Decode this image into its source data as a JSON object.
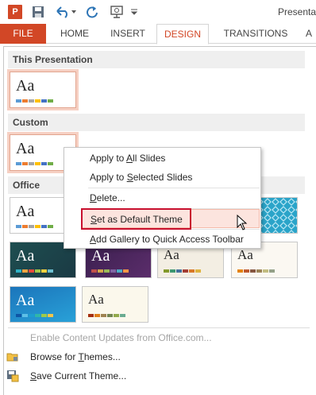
{
  "window": {
    "title_fragment": "Presenta"
  },
  "ribbon": {
    "tabs": [
      "FILE",
      "HOME",
      "INSERT",
      "DESIGN",
      "TRANSITIONS",
      "A"
    ],
    "active_tab": "DESIGN"
  },
  "sections": {
    "this_presentation": "This Presentation",
    "custom": "Custom",
    "office": "Office"
  },
  "thumb_text": "Aa",
  "context_menu": {
    "items": [
      {
        "label": "Apply to All Slides",
        "pre": "Apply to ",
        "key": "A",
        "post": "ll Slides"
      },
      {
        "label": "Apply to Selected Slides",
        "pre": "Apply to ",
        "key": "S",
        "post": "elected Slides"
      },
      {
        "label": "Delete...",
        "pre": "",
        "key": "D",
        "post": "elete..."
      },
      {
        "label": "Set as Default Theme",
        "pre": "",
        "key": "S",
        "post": "et as Default Theme"
      },
      {
        "label": "Add Gallery to Quick Access Toolbar",
        "pre": "",
        "key": "A",
        "post": "dd Gallery to Quick Access Toolbar"
      }
    ],
    "highlighted_index": 3
  },
  "bottom": {
    "enable_updates": "Enable Content Updates from Office.com...",
    "browse_pre": "Browse for ",
    "browse_key": "T",
    "browse_post": "hemes...",
    "save_pre": "",
    "save_key": "S",
    "save_post": "ave Current Theme..."
  },
  "colors": {
    "accent": "#d24726",
    "highlight_bg": "#fce4de",
    "annotation_box": "#c8102e",
    "office_theme_bars": [
      "#5b9bd5",
      "#ed7d31",
      "#a5a5a5",
      "#ffc000",
      "#4472c4",
      "#70ad47"
    ]
  }
}
